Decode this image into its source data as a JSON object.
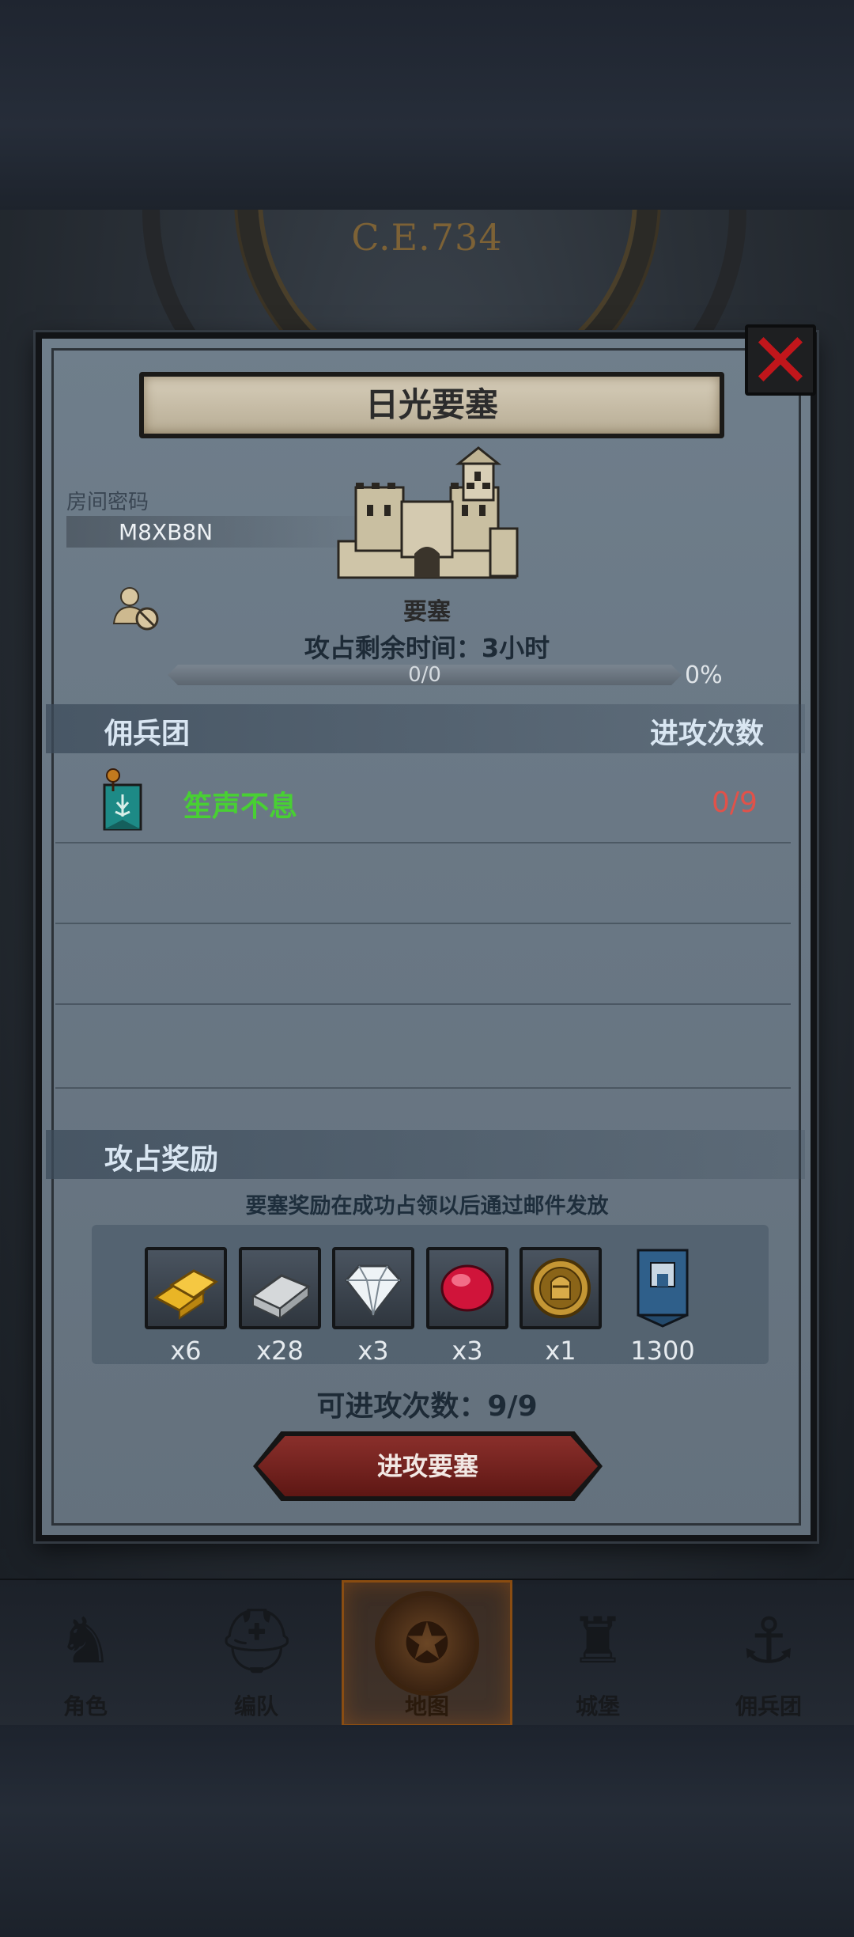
{
  "background": {
    "era_label": "C.E.734"
  },
  "dialog": {
    "title": "日光要塞",
    "room_password_label": "房间密码",
    "room_password_value": "M8XB8N",
    "fortress_label": "要塞",
    "capture_time_label": "攻占剩余时间：3小时",
    "progress": {
      "text": "0/0",
      "percent_label": "0%",
      "fraction": 0
    },
    "mercenary_header": "佣兵团",
    "attack_count_header": "进攻次数",
    "mercenaries": [
      {
        "name": "笙声不息",
        "attacks": "0/9",
        "icon": "teal-banner-icon"
      }
    ],
    "reward_header": "攻占奖励",
    "reward_note": "要塞奖励在成功占领以后通过邮件发放",
    "rewards": [
      {
        "icon": "gold-bars-icon",
        "qty": "x6",
        "color": "#d9a514"
      },
      {
        "icon": "silver-ingot-icon",
        "qty": "x28",
        "color": "#b8bcbf"
      },
      {
        "icon": "diamond-icon",
        "qty": "x3",
        "color": "#e6eef3"
      },
      {
        "icon": "ruby-icon",
        "qty": "x3",
        "color": "#d0143a"
      },
      {
        "icon": "knight-medal-icon",
        "qty": "x1",
        "color": "#b88a2c"
      },
      {
        "icon": "blue-banner-icon",
        "qty": "1300",
        "color": "#2f5f8a"
      }
    ],
    "attacks_available": "可进攻次数：9/9",
    "attack_button": "进攻要塞",
    "close_icon": "close-icon"
  },
  "bottom_nav": {
    "items": [
      {
        "label": "角色",
        "icon": "knight-icon"
      },
      {
        "label": "编队",
        "icon": "helmet-icon"
      },
      {
        "label": "地图",
        "icon": "map-icon",
        "active": true
      },
      {
        "label": "城堡",
        "icon": "castle-icon"
      },
      {
        "label": "佣兵团",
        "icon": "ship-icon"
      }
    ]
  }
}
